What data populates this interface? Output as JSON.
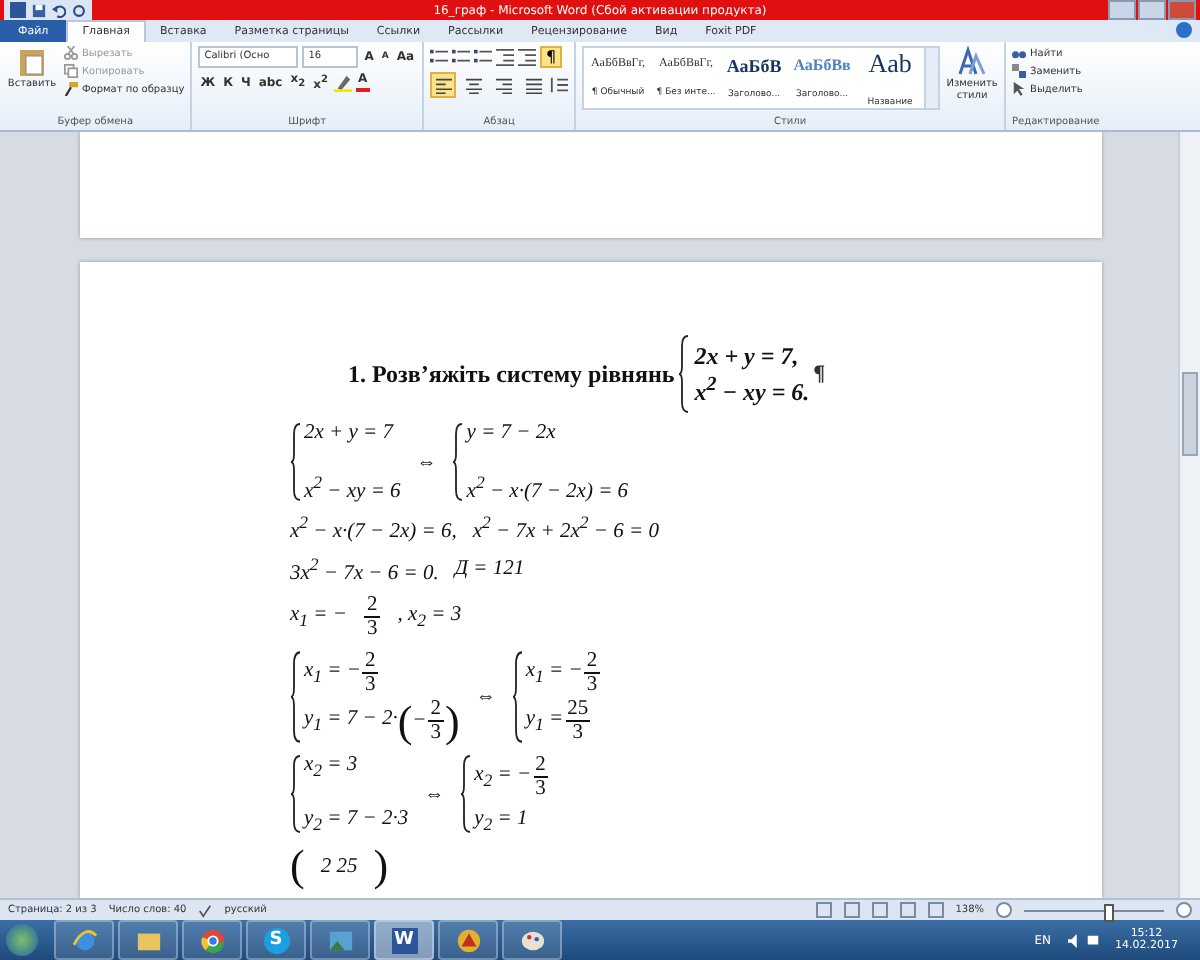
{
  "window": {
    "title": "16_граф - Microsoft Word (Сбой активации продукта)"
  },
  "tabs": [
    {
      "label": "Файл",
      "kind": "file",
      "selected": false
    },
    {
      "label": "Главная",
      "kind": "tab",
      "selected": true
    },
    {
      "label": "Вставка",
      "kind": "tab",
      "selected": false
    },
    {
      "label": "Разметка страницы",
      "kind": "tab",
      "selected": false
    },
    {
      "label": "Ссылки",
      "kind": "tab",
      "selected": false
    },
    {
      "label": "Рассылки",
      "kind": "tab",
      "selected": false
    },
    {
      "label": "Рецензирование",
      "kind": "tab",
      "selected": false
    },
    {
      "label": "Вид",
      "kind": "tab",
      "selected": false
    },
    {
      "label": "Foxit PDF",
      "kind": "tab",
      "selected": false
    }
  ],
  "ribbon": {
    "clipboard": {
      "paste": "Вставить",
      "cut": "Вырезать",
      "copy": "Копировать",
      "format_painter": "Формат по образцу",
      "label": "Буфер обмена"
    },
    "font": {
      "family": "Calibri (Осно",
      "size": "16",
      "grow": "A",
      "shrink": "A",
      "case": "Aa",
      "formats": [
        "Ж",
        "К",
        "Ч",
        "abc",
        "x$_{2}$",
        "x$^{2}$"
      ],
      "font_color": "A",
      "label": "Шрифт"
    },
    "paragraph": {
      "show_marks": {
        "label": "¶",
        "on": true
      },
      "align": [
        {
          "kind": "left",
          "selected": true
        },
        {
          "kind": "center",
          "selected": false
        },
        {
          "kind": "right",
          "selected": false
        },
        {
          "kind": "justify",
          "selected": false
        }
      ],
      "label": "Абзац"
    },
    "styles": {
      "items": [
        {
          "sample": "АаБбВвГг,",
          "name": "¶ Обычный",
          "kind": "normal"
        },
        {
          "sample": "АаБбВвГг,",
          "name": "¶ Без инте...",
          "kind": "normal"
        },
        {
          "sample": "АаБбВ",
          "name": "Заголово...",
          "kind": "heading1"
        },
        {
          "sample": "АаБбВв",
          "name": "Заголово...",
          "kind": "heading2"
        },
        {
          "sample": "Aab",
          "name": "Название",
          "kind": "title"
        }
      ],
      "change": "Изменить стили",
      "label": "Стили"
    },
    "editing": {
      "find": "Найти",
      "replace": "Заменить",
      "select": "Выделить",
      "label": "Редактирование"
    }
  },
  "document": {
    "heading": {
      "text": "1. Розв’яжіть систему рівнянь",
      "rows": [
        "2x + y = 7,",
        "x$^{2}$ − xy = 6."
      ],
      "mark": "¶"
    },
    "lines": [
      [
        {
          "kind": "sys",
          "rows": [
            {
              "parts": [
                {
                  "kind": "t",
                  "s": "2x + y = 7"
                }
              ]
            },
            {
              "parts": [
                {
                  "kind": "t",
                  "s": "x$^{2}$ − xy = 6"
                }
              ]
            }
          ]
        },
        {
          "kind": "op",
          "s": "⇔"
        },
        {
          "kind": "sys",
          "rows": [
            {
              "parts": [
                {
                  "kind": "t",
                  "s": "y = 7 − 2x"
                }
              ]
            },
            {
              "parts": [
                {
                  "kind": "t",
                  "s": "x$^{2}$ − x·(7 − 2x) = 6"
                }
              ]
            }
          ]
        }
      ],
      [
        {
          "kind": "t",
          "s": "x$^{2}$ − x·(7 − 2x) = 6,"
        },
        {
          "kind": "t",
          "s": "x$^{2}$ − 7x + 2x$^{2}$ − 6 = 0"
        }
      ],
      [
        {
          "kind": "t",
          "s": "3x$^{2}$ − 7x − 6 = 0."
        },
        {
          "kind": "t",
          "s": "Д = 121"
        }
      ],
      [
        {
          "kind": "t",
          "s": "x$_{1}$ = −"
        },
        {
          "kind": "frac",
          "num": "2",
          "den": "3"
        },
        {
          "kind": "t",
          "s": ", x$_{2}$ = 3"
        }
      ],
      [
        {
          "kind": "sys",
          "rows": [
            {
              "parts": [
                {
                  "kind": "t",
                  "s": "x$_{1}$ = −"
                },
                {
                  "kind": "frac",
                  "num": "2",
                  "den": "3"
                }
              ]
            },
            {
              "parts": [
                {
                  "kind": "t",
                  "s": "y$_{1}$ = 7 − 2·"
                },
                {
                  "kind": "big",
                  "s": "("
                },
                {
                  "kind": "t",
                  "s": "−"
                },
                {
                  "kind": "frac",
                  "num": "2",
                  "den": "3"
                },
                {
                  "kind": "big",
                  "s": ")"
                }
              ]
            }
          ]
        },
        {
          "kind": "op",
          "s": "⇔"
        },
        {
          "kind": "sys",
          "rows": [
            {
              "parts": [
                {
                  "kind": "t",
                  "s": "x$_{1}$ = −"
                },
                {
                  "kind": "frac",
                  "num": "2",
                  "den": "3"
                }
              ]
            },
            {
              "parts": [
                {
                  "kind": "t",
                  "s": "y$_{1}$ ="
                },
                {
                  "kind": "frac",
                  "num": "25",
                  "den": "3"
                }
              ]
            }
          ]
        }
      ],
      [
        {
          "kind": "sys",
          "rows": [
            {
              "parts": [
                {
                  "kind": "t",
                  "s": "x$_{2}$ = 3"
                }
              ]
            },
            {
              "parts": [
                {
                  "kind": "t",
                  "s": "y$_{2}$ = 7 − 2·3"
                }
              ]
            }
          ]
        },
        {
          "kind": "op",
          "s": "⇔"
        },
        {
          "kind": "sys",
          "rows": [
            {
              "parts": [
                {
                  "kind": "t",
                  "s": "x$_{2}$ = −"
                },
                {
                  "kind": "frac",
                  "num": "2",
                  "den": "3"
                }
              ]
            },
            {
              "parts": [
                {
                  "kind": "t",
                  "s": "y$_{2}$ = 1"
                }
              ]
            }
          ]
        }
      ],
      [
        {
          "kind": "big",
          "s": "("
        },
        {
          "kind": "t",
          "s": "2   25"
        },
        {
          "kind": "big",
          "s": ")"
        }
      ]
    ]
  },
  "status_bar": {
    "page": "Страница: 2 из 3",
    "words": "Число слов: 40",
    "language": "русский",
    "zoom": "138%",
    "zoom_slider": {
      "level": 0.6
    }
  },
  "taskbar": {
    "apps": [
      {
        "kind": "ie",
        "selected": false
      },
      {
        "kind": "folder",
        "selected": false
      },
      {
        "kind": "chrome",
        "selected": false
      },
      {
        "kind": "skype",
        "label": "S",
        "selected": false
      },
      {
        "kind": "photo",
        "selected": false
      },
      {
        "kind": "word",
        "label": "W",
        "selected": true
      },
      {
        "kind": "app",
        "selected": false
      },
      {
        "kind": "paint",
        "selected": false
      }
    ],
    "language": "EN",
    "time": "15:12",
    "date": "14.02.2017"
  }
}
